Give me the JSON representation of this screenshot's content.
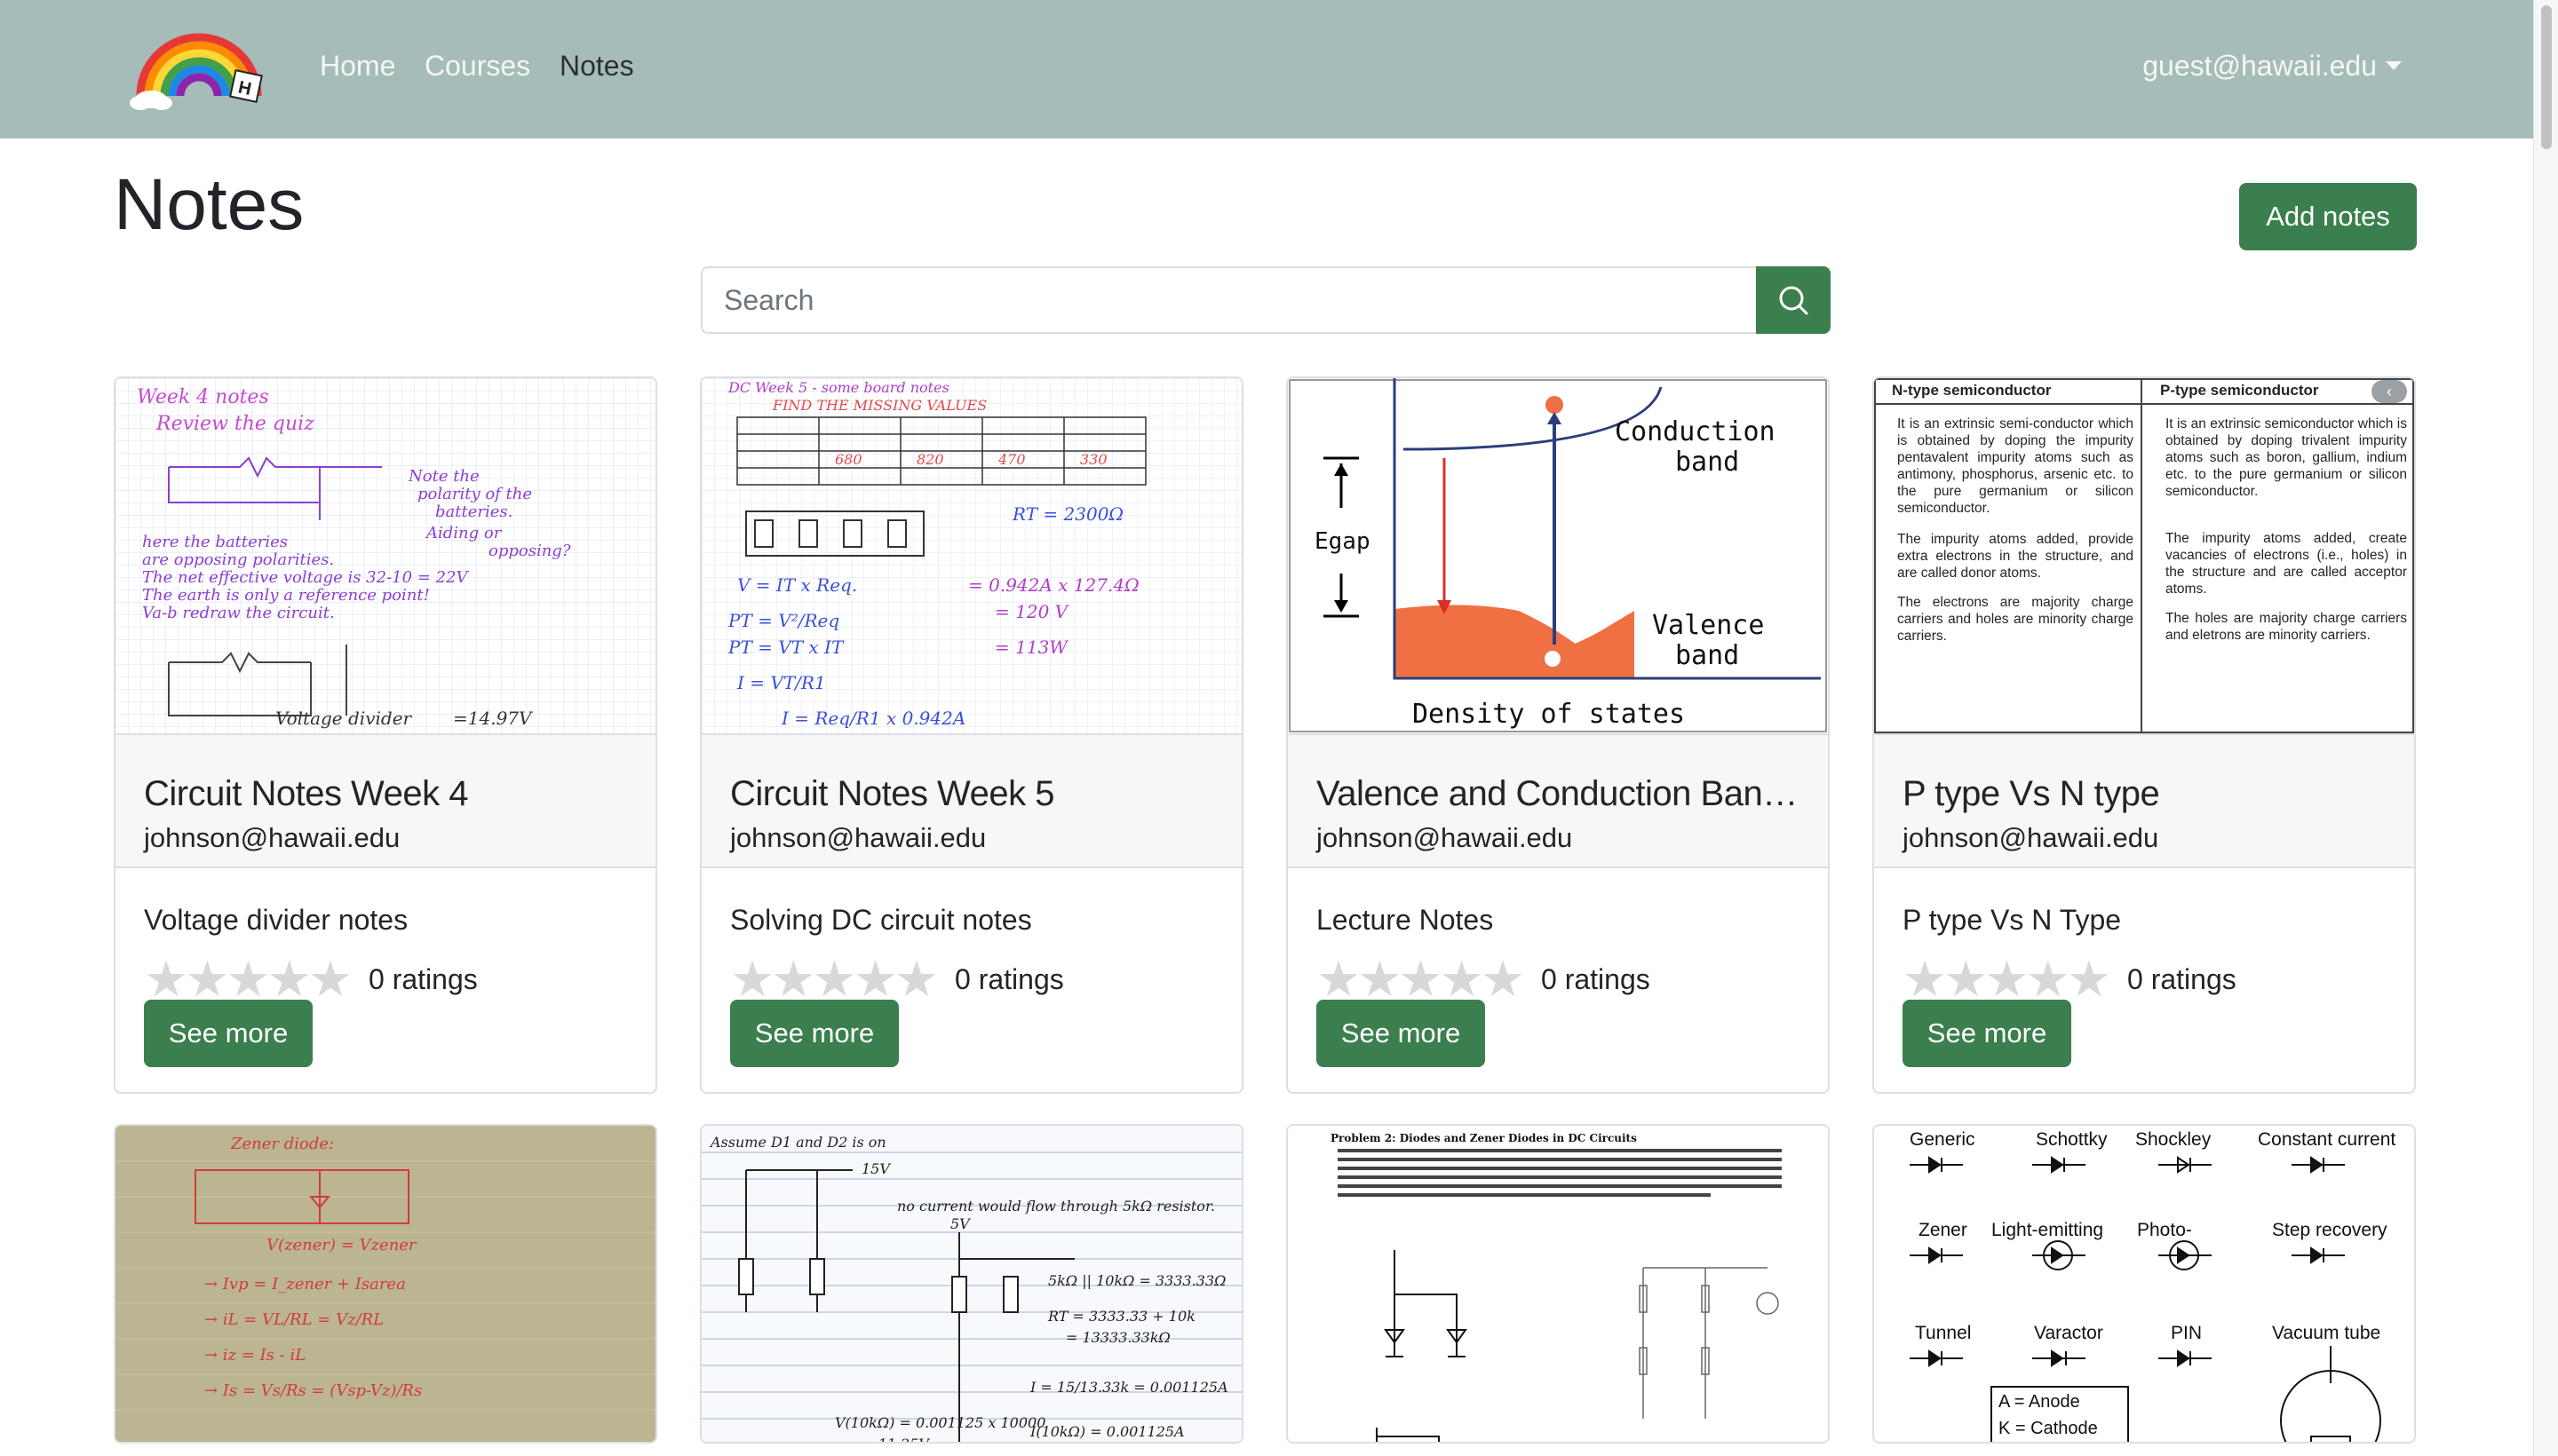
{
  "nav": {
    "links": [
      "Home",
      "Courses",
      "Notes"
    ],
    "user": "guest@hawaii.edu"
  },
  "page": {
    "title": "Notes",
    "add_button": "Add notes",
    "search_placeholder": "Search"
  },
  "cards": [
    {
      "title": "Circuit Notes Week 4",
      "author": "johnson@hawaii.edu",
      "description": "Voltage divider notes",
      "rating": 0,
      "ratings_text": "0 ratings",
      "button": "See more"
    },
    {
      "title": "Circuit Notes Week 5",
      "author": "johnson@hawaii.edu",
      "description": "Solving DC circuit notes",
      "rating": 0,
      "ratings_text": "0 ratings",
      "button": "See more"
    },
    {
      "title": "Valence and Conduction Band ...",
      "author": "johnson@hawaii.edu",
      "description": "Lecture Notes",
      "rating": 0,
      "ratings_text": "0 ratings",
      "button": "See more"
    },
    {
      "title": "P type Vs N type",
      "author": "johnson@hawaii.edu",
      "description": "P type Vs N Type",
      "rating": 0,
      "ratings_text": "0 ratings",
      "button": "See more"
    }
  ],
  "thumbnails": {
    "week4": [
      "Week 4 notes",
      "Review the quiz",
      "Voltage divider"
    ],
    "week5": [
      "DC Week 5 - some board notes",
      "FIND THE MISSING VALUES"
    ],
    "band": {
      "conduction": "Conduction",
      "conduction2": "band",
      "valence": "Valence",
      "valence2": "band",
      "egap": "Egap",
      "xlabel": "Density of states"
    },
    "pn": {
      "n_header": "N-type semiconductor",
      "p_header": "P-type semiconductor",
      "n_items": [
        "It is an extrinsic semi-conductor which is obtained by doping the impurity pentavalent impurity atoms such as antimony, phosphorus, arsenic etc. to the pure germanium or silicon semiconductor.",
        "The impurity atoms added, provide extra electrons in the structure, and are called donor atoms.",
        "The electrons are majority charge carriers and holes are minority charge carriers."
      ],
      "p_items": [
        "It is an extrinsic semiconductor which is obtained by doping trivalent impurity atoms such as boron, gallium, indium etc. to the pure germanium or silicon semiconductor.",
        "The impurity atoms added, create vacancies of electrons (i.e., holes) in the structure and are called acceptor atoms.",
        "The holes are majority charge carriers and eletrons are minority carriers."
      ]
    },
    "zener": [
      "Zener diode:",
      "V(zener) = Vzener"
    ],
    "diodes": [
      "Assume D1 and D2 is on",
      "15V",
      "5V"
    ],
    "problem": [
      "Problem 2: Diodes and Zener Diodes in DC Circuits"
    ],
    "symbols": {
      "row1": [
        "Generic",
        "Schottky",
        "Shockley",
        "Constant current"
      ],
      "row2": [
        "Zener",
        "Light-emitting",
        "Photo-",
        "Step recovery"
      ],
      "row3": [
        "Tunnel",
        "Varactor",
        "PIN",
        "Vacuum tube"
      ],
      "legend": [
        "A = Anode",
        "K = Cathode"
      ]
    }
  },
  "colors": {
    "navbar": "#a6bcb8",
    "accent_green": "#3b7f4e",
    "star_empty": "#d8d8d8"
  }
}
